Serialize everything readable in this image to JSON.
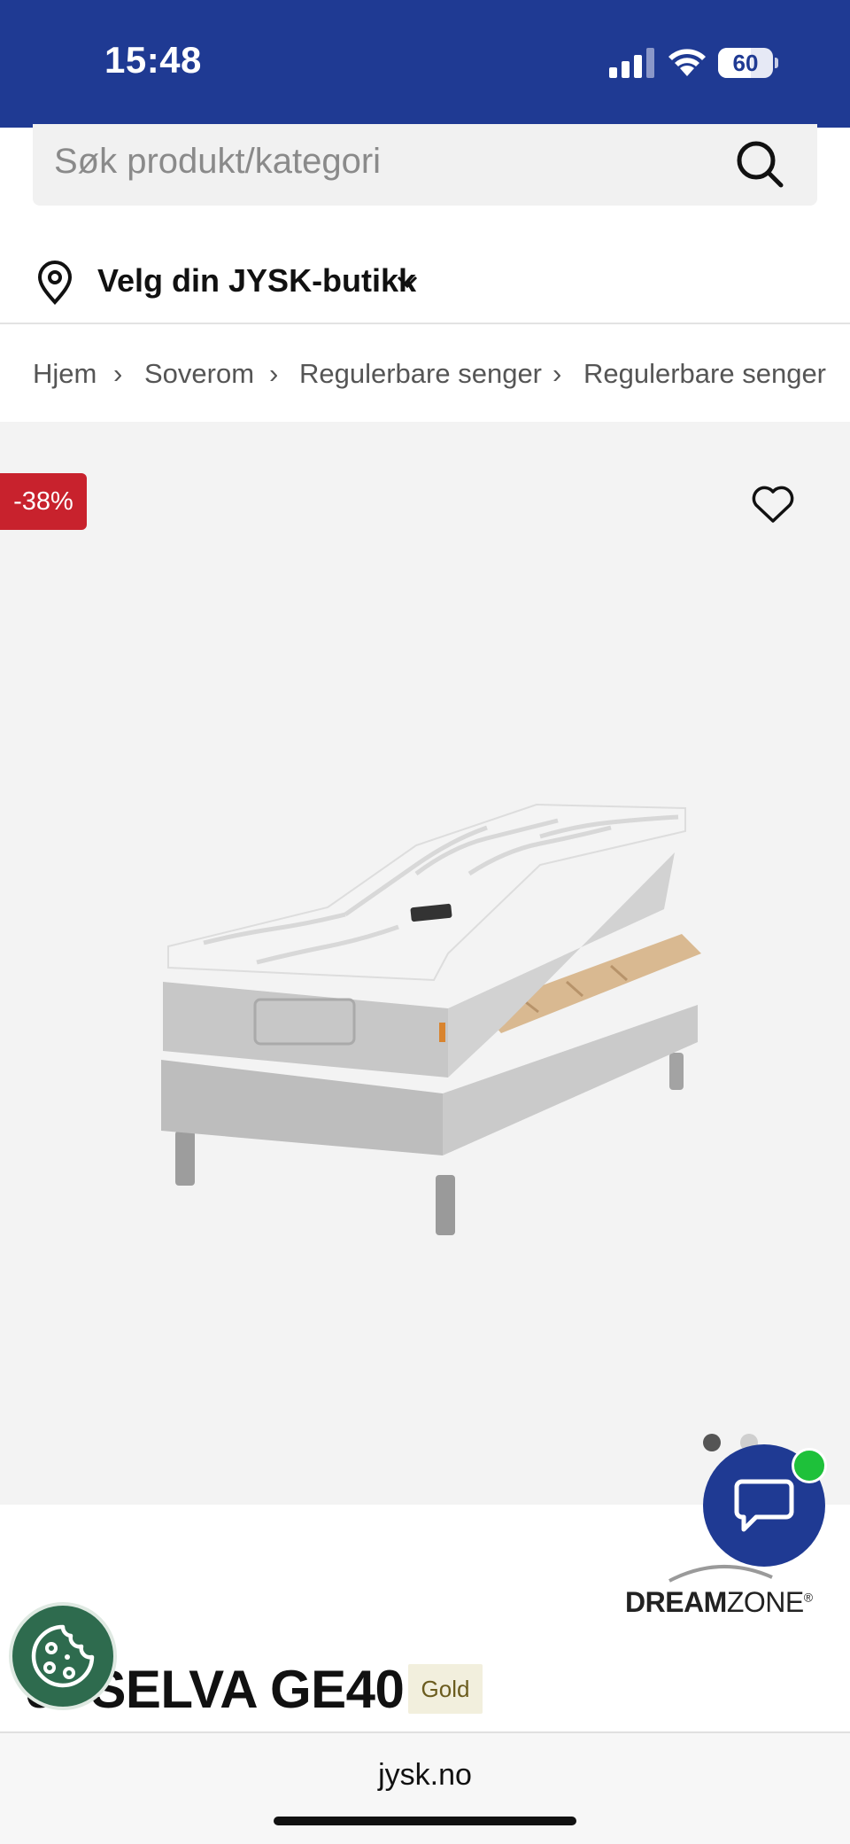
{
  "status_bar": {
    "time": "15:48",
    "battery": "60",
    "battery_level": 0.6,
    "icons": [
      "cellular-signal-icon",
      "wifi-icon",
      "battery-icon"
    ]
  },
  "search": {
    "placeholder": "Søk produkt/kategori",
    "icon": "search-icon"
  },
  "store_selector": {
    "label": "Velg din JYSK-butikk",
    "icons": [
      "location-pin-icon",
      "chevron-down-icon"
    ]
  },
  "breadcrumb": {
    "items": [
      "Hjem",
      "Soverom",
      "Regulerbare senger",
      "Regulerbare senger"
    ],
    "separator": "›"
  },
  "gallery": {
    "discount_badge": "-38%",
    "favorite_icon": "heart-icon",
    "image": "adjustable-bed-image",
    "total_images": 2,
    "active_image": 1
  },
  "chat": {
    "icon": "chat-bubble-icon",
    "status": "online"
  },
  "brand": {
    "name_bold": "DREAM",
    "name_regular": "ZONE",
    "mark": "®"
  },
  "cookie_button": {
    "icon": "cookie-icon"
  },
  "product": {
    "title": "JYSELVA GE40",
    "tier": "Gold"
  },
  "browser": {
    "url": "jysk.no"
  },
  "colors": {
    "brand_blue": "#1f3a93",
    "discount_red": "#c8222d",
    "online_green": "#1ec13a",
    "cookie_green": "#2e6b4e",
    "gallery_bg": "#f3f3f3",
    "gold_badge_bg": "#f2efdd"
  }
}
